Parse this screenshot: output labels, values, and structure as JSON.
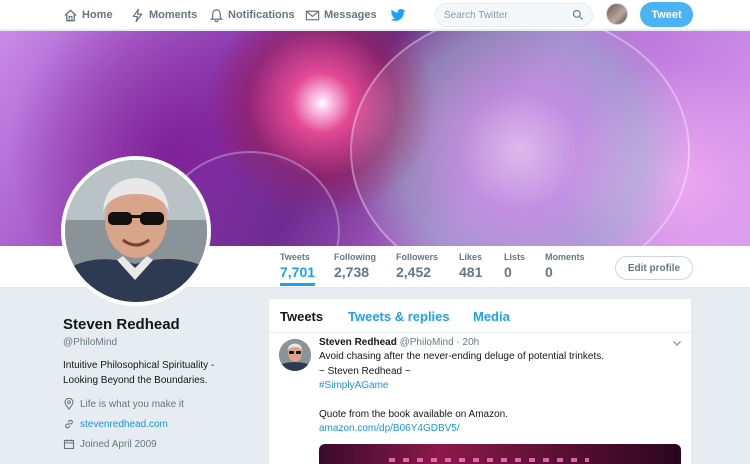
{
  "nav": {
    "home": "Home",
    "moments": "Moments",
    "notifications": "Notifications",
    "messages": "Messages",
    "search_placeholder": "Search Twitter",
    "tweet_button": "Tweet"
  },
  "stats": [
    {
      "label": "Tweets",
      "value": "7,701"
    },
    {
      "label": "Following",
      "value": "2,738"
    },
    {
      "label": "Followers",
      "value": "2,452"
    },
    {
      "label": "Likes",
      "value": "481"
    },
    {
      "label": "Lists",
      "value": "0"
    },
    {
      "label": "Moments",
      "value": "0"
    }
  ],
  "edit_profile": "Edit profile",
  "profile": {
    "name": "Steven Redhead",
    "handle": "@PhiloMind",
    "bio": "Intuitive Philosophical Spirituality - Looking Beyond the Boundaries.",
    "location": "Life is what you make it",
    "website": "stevenredhead.com",
    "joined": "Joined April 2009"
  },
  "tabs": [
    "Tweets",
    "Tweets & replies",
    "Media"
  ],
  "tweet": {
    "author": "Steven Redhead",
    "handle": "@PhiloMind",
    "time": "· 20h",
    "lines": [
      "Avoid chasing after the never-ending deluge of potential trinkets.",
      "~ Steven Redhead ~",
      "#SimplyAGame",
      "Quote from the book available on Amazon.",
      "amazon.com/dp/B06Y4GDBV5/"
    ]
  },
  "colors": {
    "accent": "#1da1f2",
    "tweet_button": "#4ab3f4",
    "background": "#e6ecf0"
  }
}
